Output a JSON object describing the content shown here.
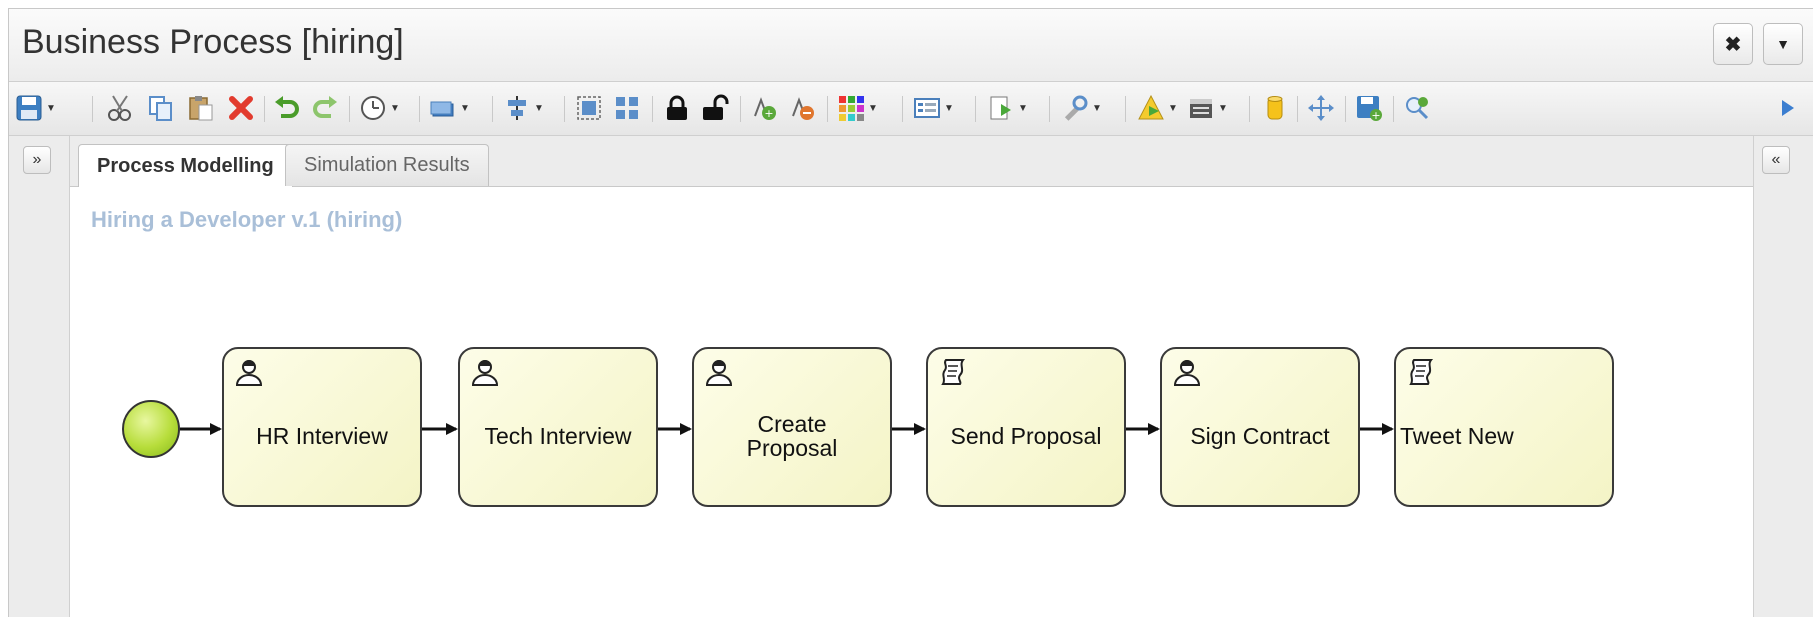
{
  "window": {
    "title": "Business Process [hiring]",
    "close_icon": "close-x-icon",
    "menu_icon": "dropdown-triangle-icon"
  },
  "toolbar": {
    "tools": [
      "save-icon",
      "cut-icon",
      "copy-icon",
      "paste-icon",
      "delete-icon",
      "undo-icon",
      "redo-icon",
      "history-icon",
      "shape-icon",
      "align-icon",
      "group-icon",
      "ungroup-icon",
      "lock-icon",
      "unlock-icon",
      "add-docker-icon",
      "remove-docker-icon",
      "color-icon",
      "properties-icon",
      "export-icon",
      "tools-icon",
      "validate-icon",
      "simulation-icon",
      "repository-icon",
      "move-icon",
      "save-as-icon",
      "zoom-icon",
      "more-icon"
    ]
  },
  "side": {
    "left_toggle": "»",
    "right_toggle": "«"
  },
  "tabs": [
    {
      "label": "Process Modelling",
      "active": true
    },
    {
      "label": "Simulation Results",
      "active": false
    }
  ],
  "process": {
    "title": "Hiring a Developer v.1 (hiring)",
    "tasks": [
      {
        "label": "HR Interview",
        "kind": "user"
      },
      {
        "label": "Tech Interview",
        "kind": "user"
      },
      {
        "label": "Create Proposal",
        "kind": "user"
      },
      {
        "label": "Send Proposal",
        "kind": "script"
      },
      {
        "label": "Sign Contract",
        "kind": "user"
      },
      {
        "label": "Tweet New",
        "kind": "script"
      }
    ]
  },
  "colors": {
    "task_fill": "#f6f6cf",
    "start_event": "#a8d62e",
    "process_title": "#a9bfd8"
  }
}
